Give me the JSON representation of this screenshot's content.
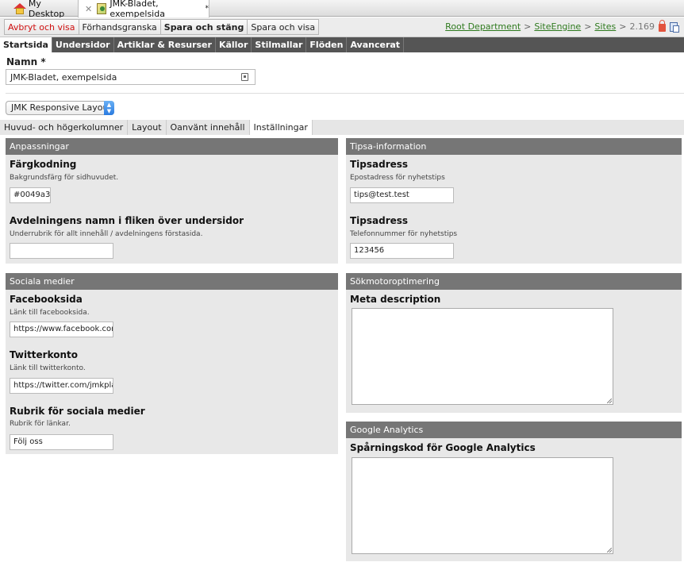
{
  "window_tabs": [
    {
      "label": "My Desktop"
    },
    {
      "label": "JMK-Bladet, exempelsida",
      "modified_marker": "*"
    }
  ],
  "toolbar": {
    "buttons": [
      "Avbryt och visa",
      "Förhandsgranska",
      "Spara och stäng",
      "Spara och visa"
    ],
    "breadcrumb": [
      "Root Department",
      "SiteEngine",
      "Sites"
    ],
    "breadcrumb_sep": ">",
    "version": "2.169"
  },
  "nav": [
    "Startsida",
    "Undersidor",
    "Artiklar & Resurser",
    "Källor",
    "Stilmallar",
    "Flöden",
    "Avancerat"
  ],
  "name": {
    "label": "Namn *",
    "value": "JMK-Bladet, exempelsida"
  },
  "layout": {
    "selected": "JMK Responsive Layout"
  },
  "subtabs": [
    "Huvud- och högerkolumner",
    "Layout",
    "Oanvänt innehåll",
    "Inställningar"
  ],
  "panels": {
    "anpassningar": {
      "title": "Anpassningar",
      "fields": [
        {
          "label": "Färgkodning",
          "help": "Bakgrundsfärg för sidhuvudet.",
          "value": "#0049a3"
        },
        {
          "label": "Avdelningens namn i fliken över undersidor",
          "help": "Underrubrik för allt innehåll / avdelningens förstasida.",
          "value": ""
        }
      ]
    },
    "tipsa": {
      "title": "Tipsa-information",
      "fields": [
        {
          "label": "Tipsadress",
          "help": "Epostadress för nyhetstips",
          "value": "tips@test.test"
        },
        {
          "label": "Tipsadress",
          "help": "Telefonnummer för nyhetstips",
          "value": "123456"
        }
      ]
    },
    "sociala": {
      "title": "Sociala medier",
      "fields": [
        {
          "label": "Facebooksida",
          "help": "Länk till facebooksida.",
          "value": "https://www.facebook.com"
        },
        {
          "label": "Twitterkonto",
          "help": "Länk till twitterkonto.",
          "value": "https://twitter.com/jmkplay"
        },
        {
          "label": "Rubrik för sociala medier",
          "help": "Rubrik för länkar.",
          "value": "Följ oss"
        }
      ]
    },
    "seo": {
      "title": "Sökmotoroptimering",
      "fields": [
        {
          "label": "Meta description",
          "value": ""
        }
      ]
    },
    "ga": {
      "title": "Google Analytics",
      "fields": [
        {
          "label": "Spårningskod för Google Analytics",
          "value": ""
        }
      ]
    }
  },
  "colors": {
    "accent_red": "#d01010",
    "link_green": "#2e7a1e",
    "nav_dark": "#555555",
    "panel_head": "#767676"
  },
  "icons": [
    "home-icon",
    "close-icon",
    "page-icon",
    "lock-icon",
    "copy-icon",
    "field-icon",
    "chevron-updown-icon",
    "resize-handle-icon"
  ]
}
